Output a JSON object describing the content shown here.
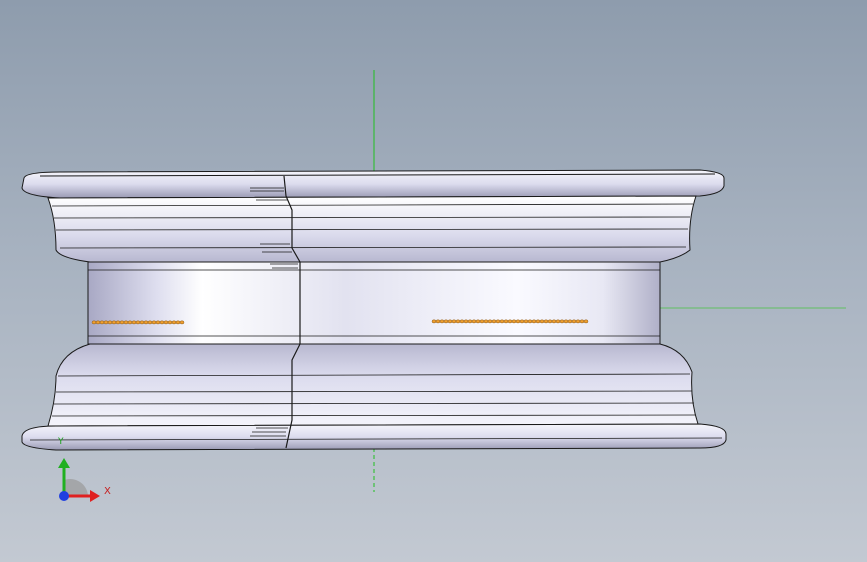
{
  "viewport": {
    "background_top": "#8e9cad",
    "background_bottom": "#c3c9d2"
  },
  "model": {
    "name": "wheel-rim",
    "body_color": "#e6e6f4",
    "edge_color": "#1a1a1a",
    "hole_pattern_color": "#f0a030"
  },
  "triad": {
    "x_label": "X",
    "y_label": "Y",
    "x_color": "#e02020",
    "y_color": "#20b020",
    "z_color": "#2040e0"
  },
  "reference_axes": {
    "vertical_color": "#20c020",
    "horizontal_color": "#60c060"
  }
}
